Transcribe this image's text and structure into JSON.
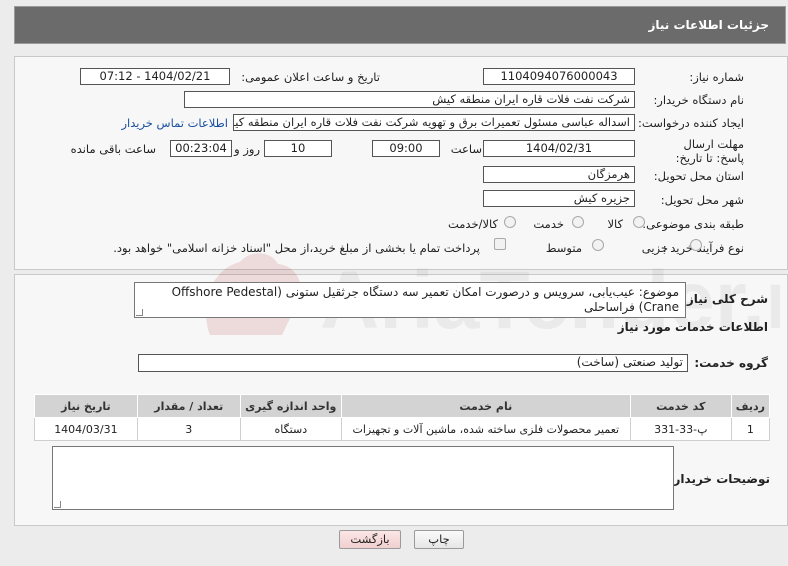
{
  "header": {
    "title": "جزئیات اطلاعات نیاز"
  },
  "form": {
    "need_number_label": "شماره نیاز:",
    "need_number": "1104094076000043",
    "announce_label": "تاریخ و ساعت اعلان عمومی:",
    "announce_value": "1404/02/21 - 07:12",
    "buyer_org_label": "نام دستگاه خریدار:",
    "buyer_org": "شرکت نفت فلات قاره ایران منطقه کیش",
    "creator_label": "ایجاد کننده درخواست:",
    "creator": "اسداله  عباسی  مسئول تعمیرات برق و تهویه  شرکت نفت فلات قاره ایران منطقه کیش",
    "contact_link": "اطلاعات تماس خریدار",
    "deadline_label": "مهلت ارسال پاسخ: تا تاریخ:",
    "deadline_date": "1404/02/31",
    "time_label": "ساعت",
    "deadline_time": "09:00",
    "days_value": "10",
    "days_label": "روز و",
    "remaining_value": "00:23:04",
    "remaining_label": "ساعت باقی مانده",
    "province_label": "استان محل تحویل:",
    "province": "هرمزگان",
    "city_label": "شهر محل تحویل:",
    "city": "جزیره کیش",
    "category_label": "طبقه بندی موضوعی:",
    "category_options": [
      "کالا",
      "خدمت",
      "کالا/خدمت"
    ],
    "purchase_label": "نوع فرآیند خرید :",
    "purchase_options": [
      "جزیی",
      "متوسط"
    ],
    "payment_note": "پرداخت تمام یا بخشی از مبلغ خرید،از محل \"اسناد خزانه اسلامی\" خواهد بود."
  },
  "summary": {
    "label": "شرح کلی نیاز:",
    "text": "موضوع: عیب‌یابی، سرویس و درصورت امکان تعمیر سه دستگاه جرثقیل ستونی (Offshore Pedestal Crane) فراساحلی"
  },
  "services": {
    "section_title": "اطلاعات خدمات مورد نیاز",
    "group_label": "گروه خدمت:",
    "group_value": "تولید صنعتی (ساخت)",
    "columns": [
      "ردیف",
      "کد خدمت",
      "نام خدمت",
      "واحد اندازه گیری",
      "تعداد / مقدار",
      "تاریخ نیاز"
    ],
    "rows": [
      [
        "1",
        "پ-33-331",
        "تعمیر محصولات فلزی ساخته شده، ماشین آلات و تجهیزات",
        "دستگاه",
        "3",
        "1404/03/31"
      ]
    ]
  },
  "buyer_notes": {
    "label": "توضیحات خریدار:",
    "value": ""
  },
  "buttons": {
    "print": "چاپ",
    "back": "بازگشت"
  },
  "watermark": {
    "text": "AriaTender.neT"
  },
  "colors": {
    "header_bg": "#6b6b6b",
    "link": "#1a4fa0",
    "back_button": "#f6dcdc"
  }
}
